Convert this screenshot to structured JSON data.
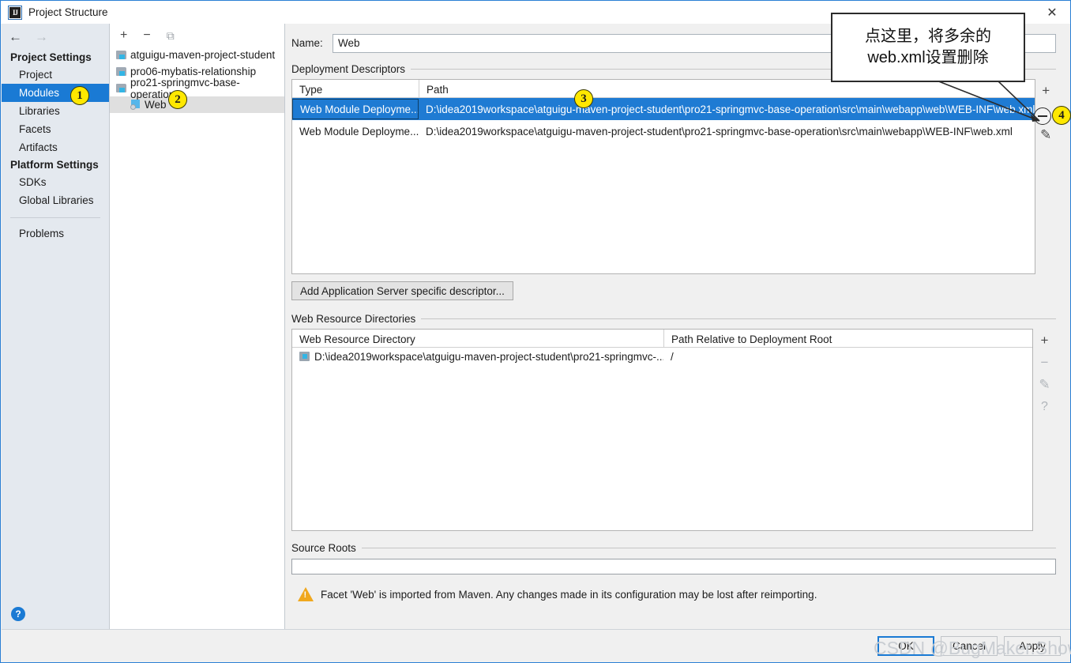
{
  "window": {
    "title": "Project Structure",
    "icon": "intellij-idea-logo",
    "close_label": "✕"
  },
  "sidebar": {
    "nav": {
      "back": "←",
      "forward": "→"
    },
    "groups": [
      {
        "heading": "Project Settings",
        "items": [
          {
            "label": "Project",
            "selected": false
          },
          {
            "label": "Modules",
            "selected": true
          },
          {
            "label": "Libraries",
            "selected": false
          },
          {
            "label": "Facets",
            "selected": false
          },
          {
            "label": "Artifacts",
            "selected": false
          }
        ]
      },
      {
        "heading": "Platform Settings",
        "items": [
          {
            "label": "SDKs",
            "selected": false
          },
          {
            "label": "Global Libraries",
            "selected": false
          }
        ]
      }
    ],
    "problems_label": "Problems",
    "help_label": "?"
  },
  "tree": {
    "toolbar": [
      {
        "name": "add-module-button",
        "glyph": "+"
      },
      {
        "name": "remove-module-button",
        "glyph": "−"
      },
      {
        "name": "copy-module-button",
        "glyph": "⧉"
      }
    ],
    "nodes": [
      {
        "label": "atguigu-maven-project-student",
        "kind": "module",
        "selected": false
      },
      {
        "label": "pro06-mybatis-relationship",
        "kind": "module",
        "selected": false
      },
      {
        "label": "pro21-springmvc-base-operation",
        "kind": "module",
        "selected": false
      },
      {
        "label": "Web",
        "kind": "facet",
        "selected": true
      }
    ]
  },
  "main": {
    "name_label": "Name:",
    "name_value": "Web",
    "deployment": {
      "title": "Deployment Descriptors",
      "columns": [
        "Type",
        "Path"
      ],
      "rows": [
        {
          "type": "Web Module Deployme...",
          "path": "D:\\idea2019workspace\\atguigu-maven-project-student\\pro21-springmvc-base-operation\\src\\main\\webapp\\web\\WEB-INF\\web.xml",
          "selected": true
        },
        {
          "type": "Web Module Deployme...",
          "path": "D:\\idea2019workspace\\atguigu-maven-project-student\\pro21-springmvc-base-operation\\src\\main\\webapp\\WEB-INF\\web.xml",
          "selected": false
        }
      ],
      "toolbar": [
        {
          "name": "add-descriptor-button",
          "glyph": "+",
          "enabled": true
        },
        {
          "name": "remove-descriptor-button",
          "glyph": "−",
          "enabled": true
        },
        {
          "name": "edit-descriptor-button",
          "glyph": "✎",
          "enabled": true
        }
      ],
      "add_server_descriptor_button": "Add Application Server specific descriptor..."
    },
    "web_resources": {
      "title": "Web Resource Directories",
      "columns": [
        "Web Resource Directory",
        "Path Relative to Deployment Root"
      ],
      "rows": [
        {
          "directory": "D:\\idea2019workspace\\atguigu-maven-project-student\\pro21-springmvc-...",
          "relative": "/"
        }
      ],
      "toolbar": [
        {
          "name": "add-resource-dir-button",
          "glyph": "+",
          "enabled": true
        },
        {
          "name": "remove-resource-dir-button",
          "glyph": "−",
          "enabled": false
        },
        {
          "name": "edit-resource-dir-button",
          "glyph": "✎",
          "enabled": false
        },
        {
          "name": "help-resource-dir-button",
          "glyph": "?",
          "enabled": false
        }
      ]
    },
    "source_roots": {
      "title": "Source Roots",
      "value": ""
    },
    "warning": "Facet 'Web' is imported from Maven. Any changes made in its configuration may be lost after reimporting."
  },
  "footer": {
    "ok": "OK",
    "cancel": "Cancel",
    "apply": "Apply"
  },
  "annotations": {
    "markers": [
      {
        "id": "1",
        "target": "modules-sidebar-item"
      },
      {
        "id": "2",
        "target": "web-facet-tree-node"
      },
      {
        "id": "3",
        "target": "selected-descriptor-row"
      },
      {
        "id": "4",
        "target": "remove-descriptor-button"
      }
    ],
    "callout": {
      "line1": "点这里，将多余的",
      "line2": "web.xml设置删除"
    },
    "watermark": "CSDN @BugMaker.Showy",
    "highlight_color": "#ffe800",
    "selection_color": "#1f7bd3"
  }
}
